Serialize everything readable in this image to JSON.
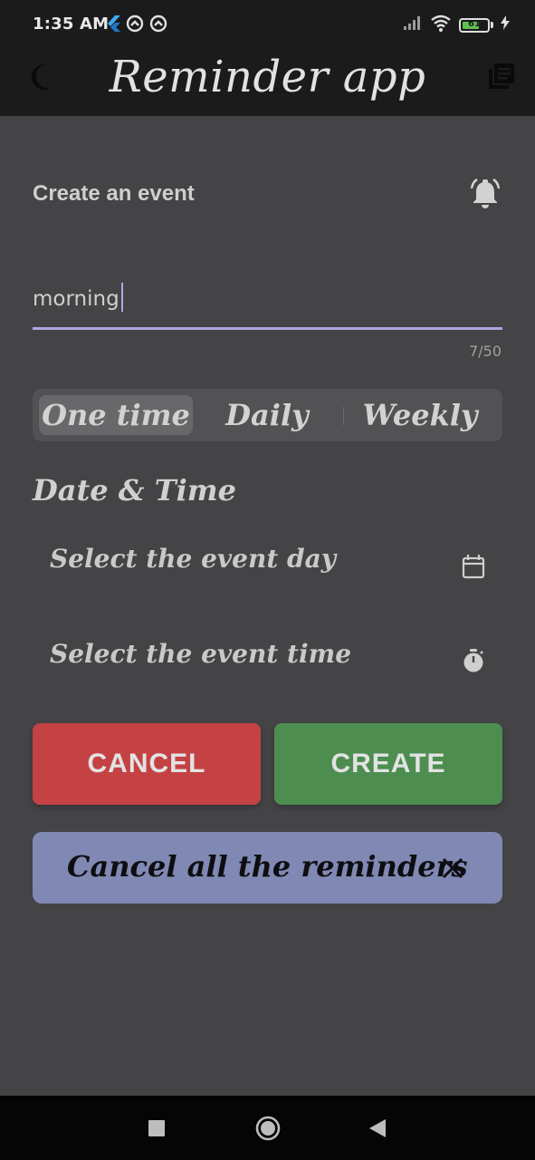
{
  "status_bar": {
    "time": "1:35 AM",
    "battery_level": "61",
    "icons": [
      "flutter-icon",
      "sync-icon",
      "sync-icon",
      "signal-icon",
      "wifi-icon",
      "battery-icon",
      "charging-icon"
    ]
  },
  "app_bar": {
    "title": "Reminder app",
    "left_icon": "moon-icon",
    "right_icon": "library-icon"
  },
  "form": {
    "section_title": "Create an event",
    "section_icon": "alarm-bell-icon",
    "event_name_value": "morning",
    "char_counter": "7/50",
    "frequency_options": [
      "One time",
      "Daily",
      "Weekly"
    ],
    "frequency_selected": "One time",
    "date_time_title": "Date & Time",
    "select_day_label": "Select the event day",
    "select_day_icon": "calendar-icon",
    "select_time_label": "Select the event time",
    "select_time_icon": "timer-icon"
  },
  "actions": {
    "cancel_label": "CANCEL",
    "create_label": "CREATE"
  },
  "banner": {
    "text": "Cancel all the reminders",
    "close_icon": "close-icon"
  },
  "colors": {
    "background": "#444446",
    "app_bar": "#1b1b1c",
    "accent": "#b0a6e2",
    "cancel": "#c44244",
    "create": "#4d8e50",
    "banner": "#8089b3"
  }
}
